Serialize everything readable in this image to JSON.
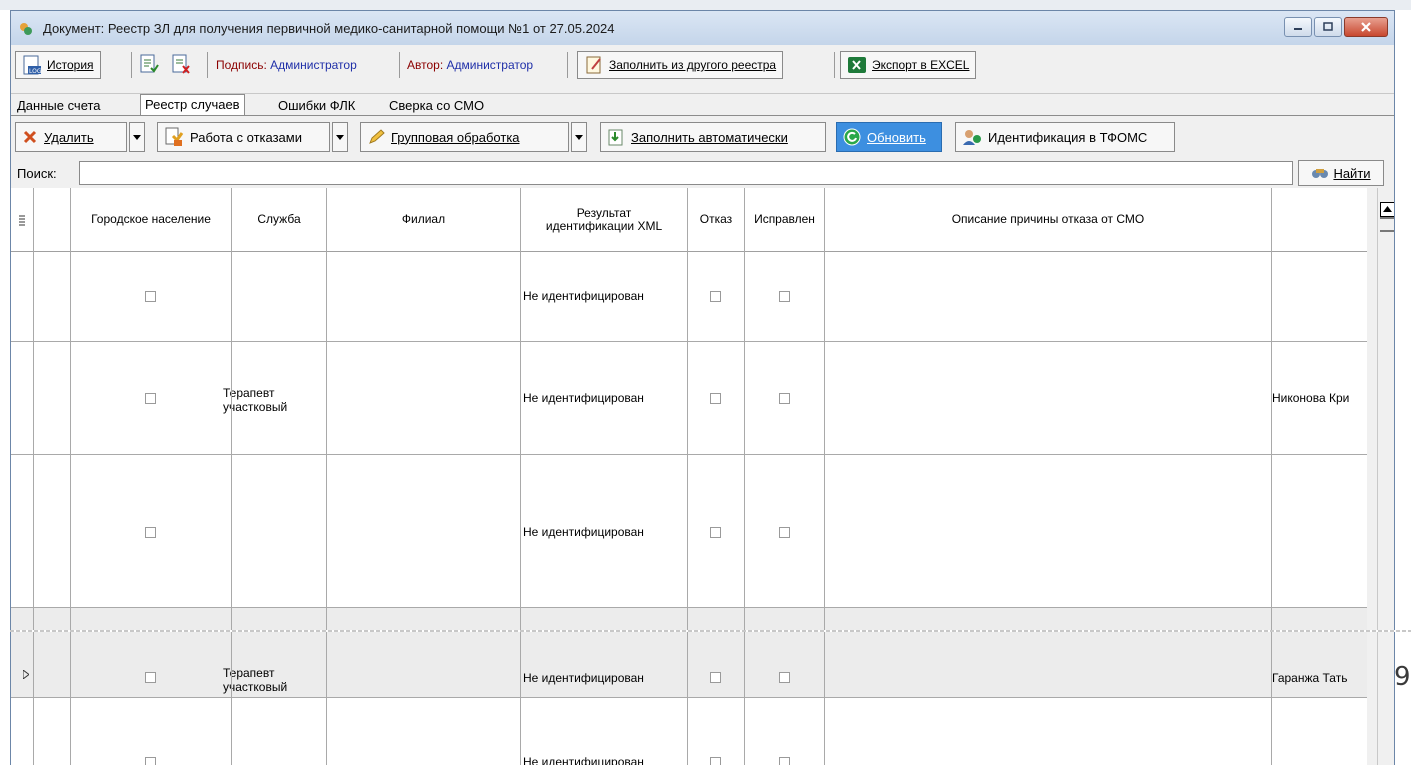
{
  "window": {
    "title": "Документ: Реестр ЗЛ для получения первичной медико-санитарной помощи №1 от 27.05.2024"
  },
  "toolbar": {
    "history": "История",
    "sign_label": "Подпись:",
    "sign_value": "Администратор",
    "author_label": "Автор:",
    "author_value": "Администратор",
    "fill_from_other": "Заполнить из другого реестра",
    "export_excel": "Экспорт в EXCEL"
  },
  "tabs": [
    "Данные счета",
    "Реестр случаев",
    "Ошибки ФЛК",
    "Сверка со СМО"
  ],
  "toolbar2": {
    "delete": "Удалить",
    "refusals": "Работа с отказами",
    "group_processing": "Групповая обработка",
    "fill_auto": "Заполнить автоматически",
    "refresh": "Обновить",
    "identify": "Идентификация в ТФОМС"
  },
  "search": {
    "label": "Поиск:",
    "value": "",
    "find": "Найти"
  },
  "grid": {
    "columns": [
      "Городское население",
      "Служба",
      "Филиал",
      "Результат идентификации XML",
      "Отказ",
      "Исправлен",
      "Описание причины отказа от СМО"
    ],
    "rows": [
      {
        "service": "",
        "result": "Не идентифицирован",
        "extra": ""
      },
      {
        "service": "Терапевт участковый",
        "result": "Не идентифицирован",
        "extra": "Никонова Кри"
      },
      {
        "service": "",
        "result": "Не идентифицирован",
        "extra": ""
      },
      {
        "service": "Терапевт участковый",
        "result": "Не идентифицирован",
        "extra": "Гаранжа Тать"
      },
      {
        "service": "",
        "result": "Не идентифицирован",
        "extra": ""
      }
    ]
  },
  "page_number": "9"
}
